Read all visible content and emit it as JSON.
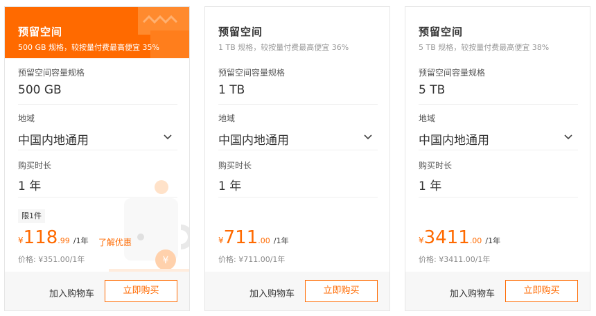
{
  "cards": [
    {
      "title": "预留空间",
      "subtitle": "500 GB 规格，较按量付费最高便宜 35%",
      "capacity_label": "预留空间容量规格",
      "capacity_value": "500 GB",
      "region_label": "地域",
      "region_value": "中国内地通用",
      "duration_label": "购买时长",
      "duration_value": "1 年",
      "limit_badge": "限1件",
      "currency": "¥",
      "price_int": "118",
      "price_dec": ".99",
      "price_unit": "/1年",
      "promo_link": "了解优惠",
      "original_price": "价格: ¥351.00/1年",
      "cart_button": "加入购物车",
      "buy_button": "立即购买"
    },
    {
      "title": "预留空间",
      "subtitle": "1 TB 规格，较按量付费最高便宜 36%",
      "capacity_label": "预留空间容量规格",
      "capacity_value": "1 TB",
      "region_label": "地域",
      "region_value": "中国内地通用",
      "duration_label": "购买时长",
      "duration_value": "1 年",
      "currency": "¥",
      "price_int": "711",
      "price_dec": ".00",
      "price_unit": "/1年",
      "original_price": "价格: ¥711.00/1年",
      "cart_button": "加入购物车",
      "buy_button": "立即购买"
    },
    {
      "title": "预留空间",
      "subtitle": "5 TB 规格，较按量付费最高便宜 38%",
      "capacity_label": "预留空间容量规格",
      "capacity_value": "5 TB",
      "region_label": "地域",
      "region_value": "中国内地通用",
      "duration_label": "购买时长",
      "duration_value": "1 年",
      "currency": "¥",
      "price_int": "3411",
      "price_dec": ".00",
      "price_unit": "/1年",
      "original_price": "价格: ¥3411.00/1年",
      "cart_button": "加入购物车",
      "buy_button": "立即购买"
    }
  ],
  "colors": {
    "accent": "#ff6a00",
    "footer_bg": "#f7f7f7",
    "border": "#e6e6e6"
  },
  "icons": {
    "region_dropdown": "chevron-down-icon",
    "header_decoration": "wave-decoration-icon",
    "promo_illustration": "coin-illustration"
  }
}
